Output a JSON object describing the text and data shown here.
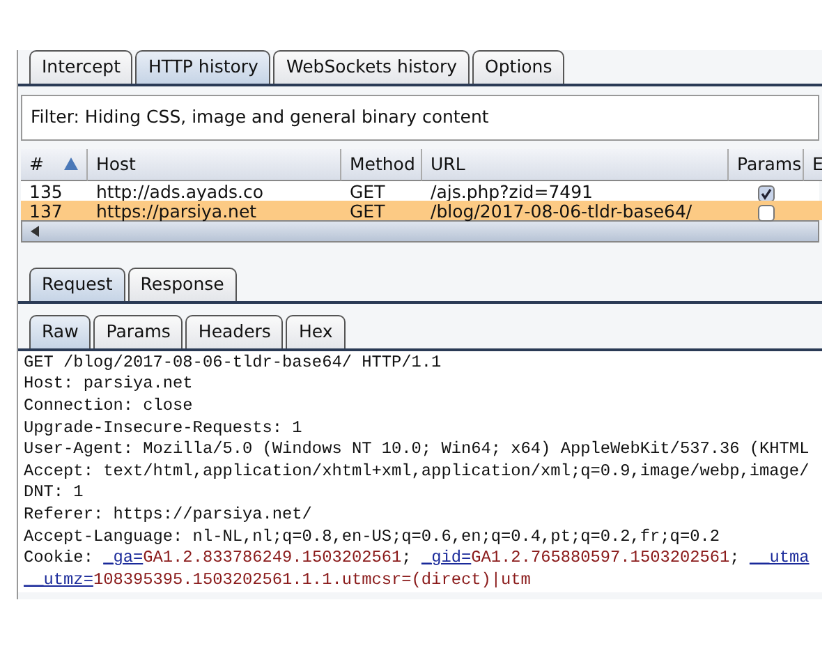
{
  "tabs": [
    {
      "label": "Intercept",
      "selected": false
    },
    {
      "label": "HTTP history",
      "selected": true
    },
    {
      "label": "WebSockets history",
      "selected": false
    },
    {
      "label": "Options",
      "selected": false
    }
  ],
  "filter": "Filter:  Hiding CSS, image and general binary content",
  "table": {
    "columns": [
      "#",
      "Host",
      "Method",
      "URL",
      "Params",
      "E"
    ],
    "rows": [
      {
        "cells": [
          "135",
          "http://ads.ayads.co",
          "GET",
          "/ajs.php?zid=7491"
        ],
        "params": true,
        "selected": false
      },
      {
        "cells": [
          "137",
          "https://parsiya.net",
          "GET",
          "/blog/2017-08-06-tldr-base64/"
        ],
        "params": false,
        "selected": true
      }
    ]
  },
  "message_tabs": [
    {
      "label": "Request",
      "selected": true
    },
    {
      "label": "Response",
      "selected": false
    }
  ],
  "view_tabs": [
    {
      "label": "Raw",
      "selected": true
    },
    {
      "label": "Params",
      "selected": false
    },
    {
      "label": "Headers",
      "selected": false
    },
    {
      "label": "Hex",
      "selected": false
    }
  ],
  "raw_lines": [
    [
      {
        "kind": "plain",
        "text": "GET /blog/2017-08-06-tldr-base64/ HTTP/1.1"
      }
    ],
    [
      {
        "kind": "plain",
        "text": "Host: parsiya.net"
      }
    ],
    [
      {
        "kind": "plain",
        "text": "Connection: close"
      }
    ],
    [
      {
        "kind": "plain",
        "text": "Upgrade-Insecure-Requests: 1"
      }
    ],
    [
      {
        "kind": "plain",
        "text": "User-Agent: Mozilla/5.0 (Windows NT 10.0; Win64; x64) AppleWebKit/537.36 (KHTML"
      }
    ],
    [
      {
        "kind": "plain",
        "text": "Accept: text/html,application/xhtml+xml,application/xml;q=0.9,image/webp,image/"
      }
    ],
    [
      {
        "kind": "plain",
        "text": "DNT: 1"
      }
    ],
    [
      {
        "kind": "plain",
        "text": "Referer: https://parsiya.net/"
      }
    ],
    [
      {
        "kind": "plain",
        "text": "Accept-Language: nl-NL,nl;q=0.8,en-US;q=0.6,en;q=0.4,pt;q=0.2,fr;q=0.2"
      }
    ],
    [
      {
        "kind": "plain",
        "text": "Cookie: "
      },
      {
        "kind": "name",
        "text": "_ga="
      },
      {
        "kind": "value",
        "text": "GA1.2.833786249.1503202561"
      },
      {
        "kind": "plain",
        "text": "; "
      },
      {
        "kind": "name",
        "text": "_gid="
      },
      {
        "kind": "value",
        "text": "GA1.2.765880597.1503202561"
      },
      {
        "kind": "plain",
        "text": "; "
      },
      {
        "kind": "name",
        "text": "__utma"
      }
    ],
    [
      {
        "kind": "name",
        "text": "__utmz="
      },
      {
        "kind": "value",
        "text": "108395395.1503202561.1.1.utmcsr=(direct)|utm"
      }
    ]
  ]
}
